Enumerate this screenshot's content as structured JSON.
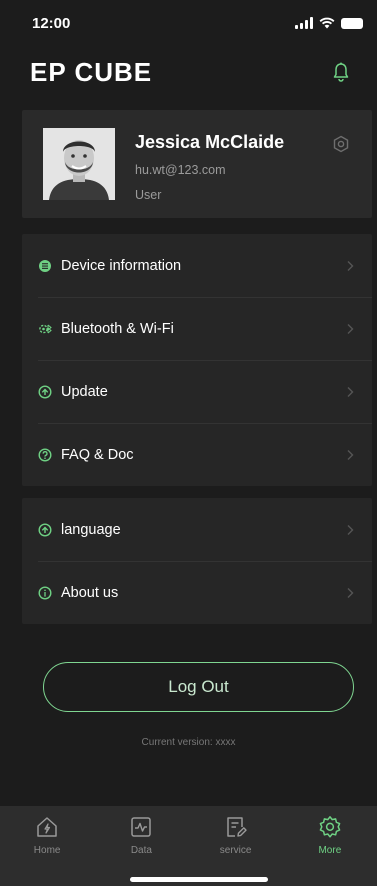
{
  "status_bar": {
    "time": "12:00"
  },
  "header": {
    "brand": "EP CUBE"
  },
  "profile": {
    "name": "Jessica McClaide",
    "email": "hu.wt@123.com",
    "role": "User"
  },
  "menu_group_1": {
    "items": [
      {
        "label": "Device information",
        "icon": "device-info-icon"
      },
      {
        "label": "Bluetooth & Wi-Fi",
        "icon": "bluetooth-wifi-icon"
      },
      {
        "label": "Update",
        "icon": "update-icon"
      },
      {
        "label": "FAQ & Doc",
        "icon": "faq-icon"
      }
    ]
  },
  "menu_group_2": {
    "items": [
      {
        "label": "language",
        "icon": "language-icon"
      },
      {
        "label": "About us",
        "icon": "info-icon"
      }
    ]
  },
  "logout_label": "Log Out",
  "version_text": "Current version: xxxx",
  "tabbar": {
    "tabs": [
      {
        "label": "Home",
        "icon": "home-icon"
      },
      {
        "label": "Data",
        "icon": "data-icon"
      },
      {
        "label": "service",
        "icon": "service-icon"
      },
      {
        "label": "More",
        "icon": "settings-icon",
        "active": true
      }
    ]
  },
  "colors": {
    "accent": "#6fd184",
    "background": "#1c1c1c",
    "card": "#2a2a2a"
  }
}
